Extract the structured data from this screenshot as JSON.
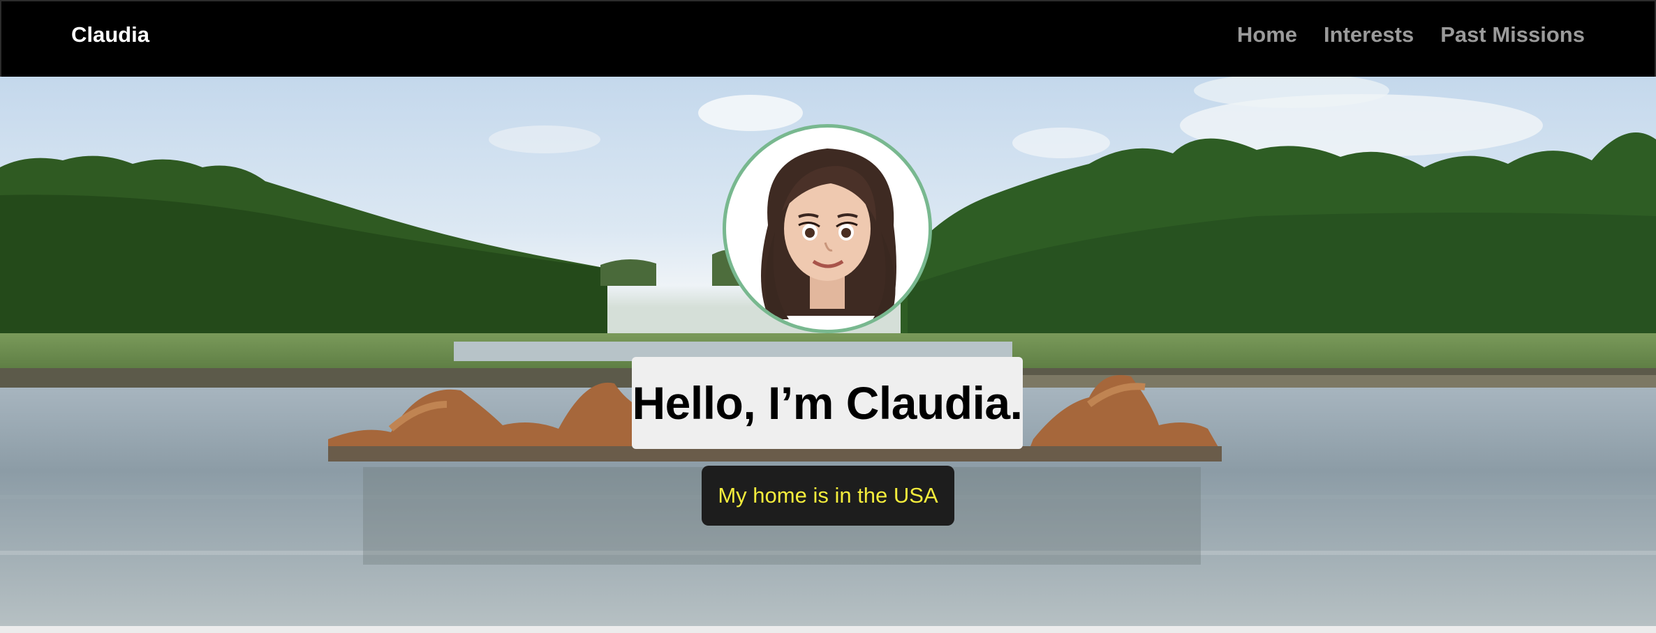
{
  "navbar": {
    "brand": "Claudia",
    "links": [
      "Home",
      "Interests",
      "Past Missions"
    ]
  },
  "hero": {
    "headline": "Hello, I’m Claudia.",
    "tagline": "My home is in the USA",
    "background_image": "fountain-garden-photo",
    "avatar_image": "memoji-avatar"
  },
  "colors": {
    "navbar_bg": "#000000",
    "brand_text": "#ffffff",
    "nav_link_text": "#9a9a9a",
    "avatar_border": "#78b88f",
    "headline_bg": "#efefef",
    "tagline_bg": "#1d1d1d",
    "tagline_text": "#f3ec3c"
  }
}
